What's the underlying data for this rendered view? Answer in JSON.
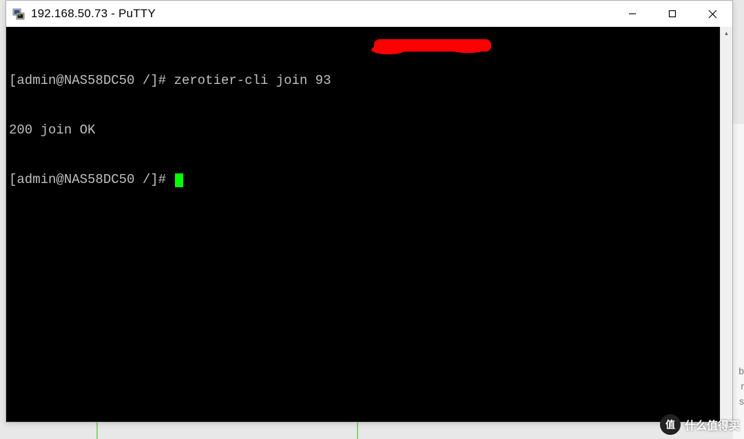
{
  "window": {
    "title": "192.168.50.73 - PuTTY"
  },
  "terminal": {
    "line1_prompt": "[admin@NAS58DC50 /]# ",
    "line1_cmd": "zerotier-cli join 93",
    "line2": "200 join OK",
    "line3_prompt": "[admin@NAS58DC50 /]# "
  },
  "bg": {
    "t1": "b",
    "t2": "r",
    "t3": "s"
  },
  "watermark": {
    "badge": "值",
    "text": "什么值得买"
  }
}
